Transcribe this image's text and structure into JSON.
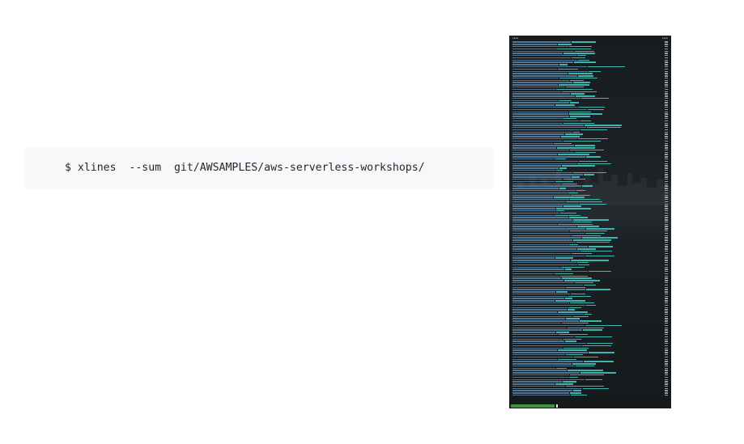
{
  "code_block": {
    "command": "$ xlines  --sum  git/AWSAMPLES/aws-serverless-workshops/"
  },
  "terminal_screenshot": {
    "colors": {
      "background": "#1b1f22",
      "path_text": "#5a86a8",
      "file_text": "#40c8c0",
      "count_text": "#cfd6da",
      "prompt": "#3fae3f"
    }
  }
}
